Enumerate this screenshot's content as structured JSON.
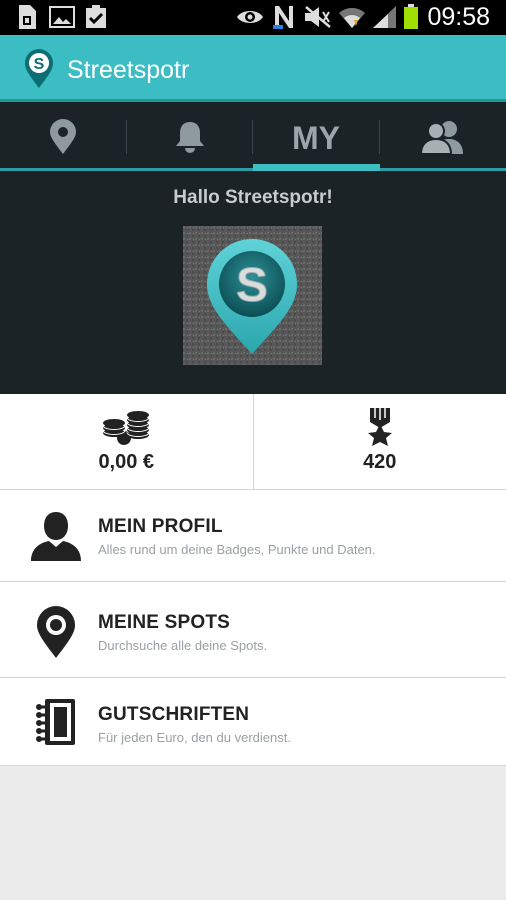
{
  "status_bar": {
    "time": "09:58",
    "icons": [
      "sim-card-icon",
      "image-icon",
      "clipboard-check-icon",
      "eye-icon",
      "nfc-icon",
      "mute-icon",
      "wifi-icon",
      "signal-icon",
      "battery-icon"
    ]
  },
  "app_bar": {
    "title": "Streetspotr",
    "logo_letter": "S"
  },
  "tabs": [
    {
      "name": "map-pin-icon",
      "active": false
    },
    {
      "name": "bell-icon",
      "active": false
    },
    {
      "label": "MY",
      "active": true
    },
    {
      "name": "people-icon",
      "active": false
    }
  ],
  "hero": {
    "greeting": "Hallo Streetspotr!",
    "avatar_letter": "S"
  },
  "stats": {
    "money": "0,00 €",
    "points": "420"
  },
  "menu": [
    {
      "title": "MEIN PROFIL",
      "subtitle": "Alles rund um deine Badges, Punkte und Daten.",
      "icon": "person-icon"
    },
    {
      "title": "MEINE SPOTS",
      "subtitle": "Durchsuche alle deine Spots.",
      "icon": "location-pin-icon"
    },
    {
      "title": "GUTSCHRIFTEN",
      "subtitle": "Für jeden Euro, den du verdienst.",
      "icon": "notebook-icon"
    }
  ],
  "colors": {
    "accent": "#3cbcc3",
    "dark": "#1c2326"
  }
}
